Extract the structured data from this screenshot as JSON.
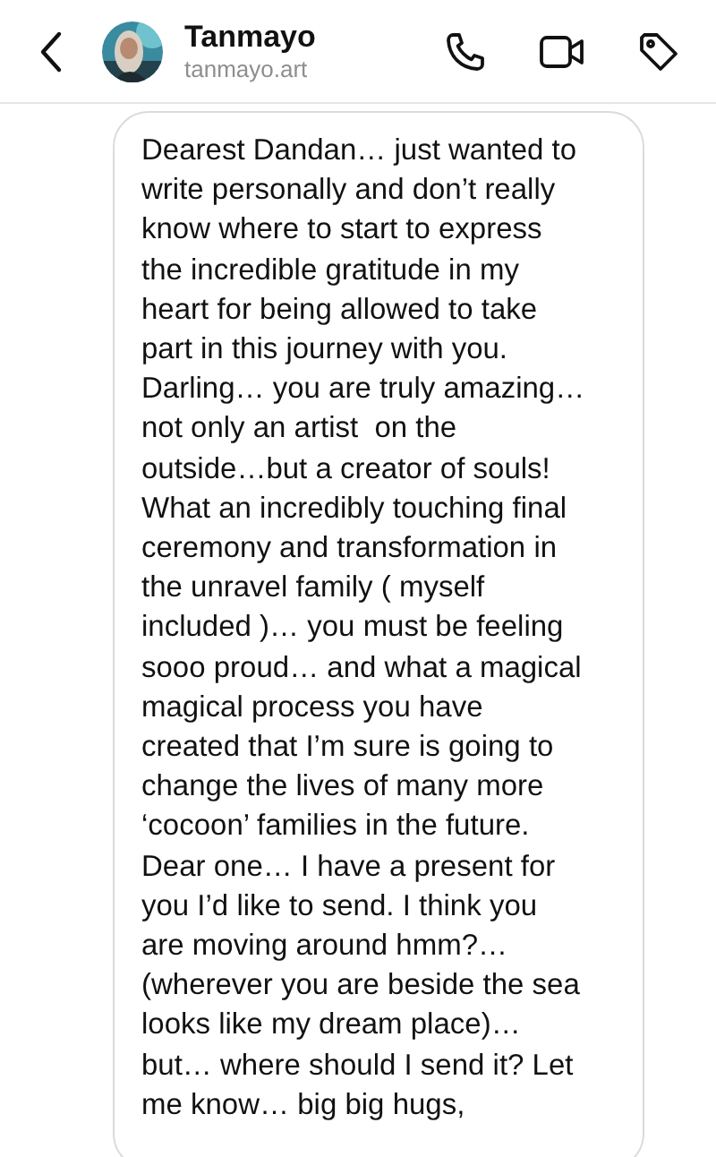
{
  "header": {
    "name": "Tanmayo",
    "username": "tanmayo.art"
  },
  "message": {
    "lines": [
      "Dearest Dandan… just wanted to",
      "write personally and don’t really",
      "know where to start to express",
      "the incredible gratitude in my",
      "heart for being allowed to take",
      "part in this journey with you.",
      "Darling… you are truly amazing…",
      "not only an artist  on the",
      "outside…but a creator of souls!",
      "What an incredibly touching final",
      "ceremony and transformation in",
      "the unravel family ( myself",
      "included )… you must be feeling",
      "sooo proud… and what a magical",
      "magical process you have",
      "created that I’m sure is going to",
      "change the lives of many more",
      "‘cocoon’ families in the future.",
      "Dear one… I have a present for",
      "you I’d like to send. I think you",
      "are moving around hmm?…",
      "(wherever you are beside the sea",
      "looks like my dream place)…",
      "but… where should I send it? Let",
      "me know… big big hugs,"
    ]
  }
}
